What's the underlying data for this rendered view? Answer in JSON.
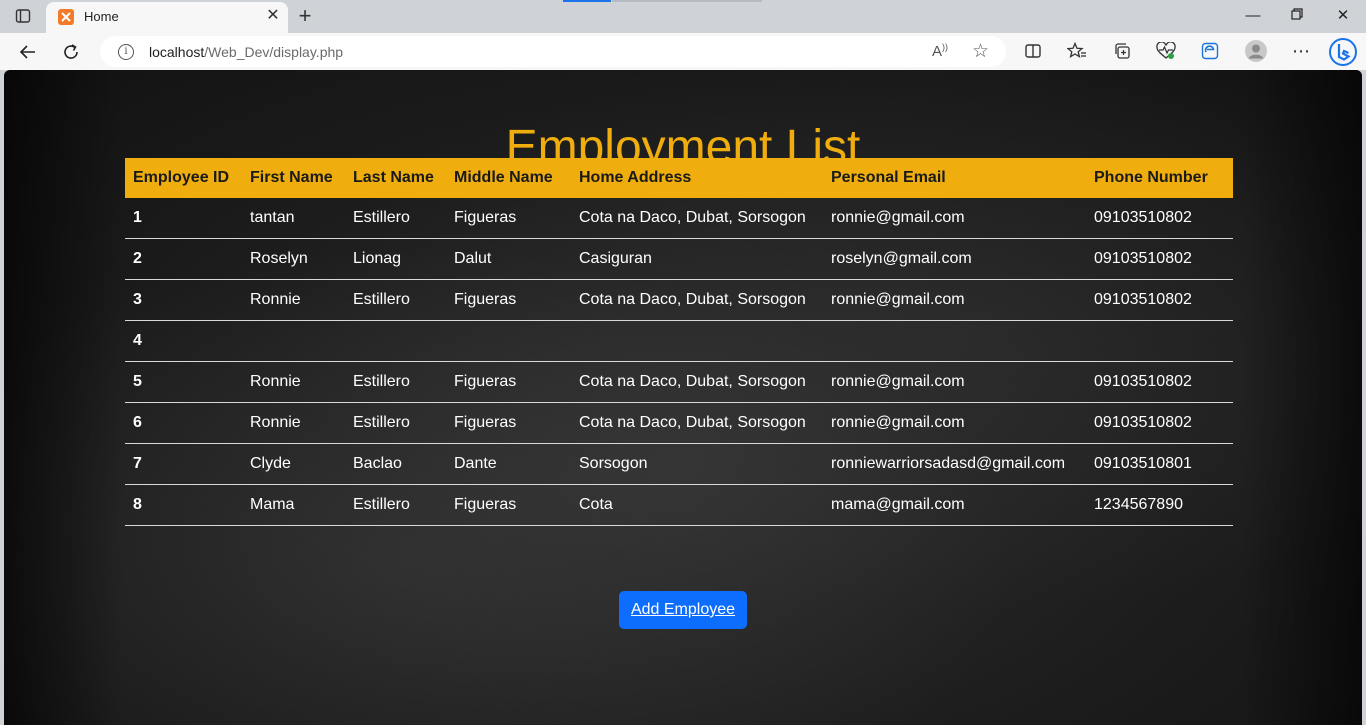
{
  "browser": {
    "tab": {
      "title": "Home"
    },
    "url": {
      "host": "localhost",
      "path": "/Web_Dev/display.php"
    },
    "icons": [
      "sidebar-icon",
      "xampp-favicon",
      "close-icon",
      "plus-icon",
      "minimize-icon",
      "restore-icon",
      "window-close-icon",
      "back-icon",
      "refresh-icon",
      "info-icon",
      "read-aloud-icon",
      "favorite-star-icon",
      "split-screen-icon",
      "favorites-icon",
      "collections-icon",
      "health-icon",
      "edge-icon",
      "profile-avatar",
      "more-icon",
      "bing-icon"
    ]
  },
  "page": {
    "heading": "Employment List",
    "table": {
      "headers": [
        "Employee ID",
        "First Name",
        "Last Name",
        "Middle Name",
        "Home Address",
        "Personal Email",
        "Phone Number"
      ],
      "rows": [
        [
          "1",
          "tantan",
          "Estillero",
          "Figueras",
          "Cota na Daco, Dubat, Sorsogon",
          "ronnie@gmail.com",
          "09103510802"
        ],
        [
          "2",
          "Roselyn",
          "Lionag",
          "Dalut",
          "Casiguran",
          "roselyn@gmail.com",
          "09103510802"
        ],
        [
          "3",
          "Ronnie",
          "Estillero",
          "Figueras",
          "Cota na Daco, Dubat, Sorsogon",
          "ronnie@gmail.com",
          "09103510802"
        ],
        [
          "4",
          "",
          "",
          "",
          "",
          "",
          ""
        ],
        [
          "5",
          "Ronnie",
          "Estillero",
          "Figueras",
          "Cota na Daco, Dubat, Sorsogon",
          "ronnie@gmail.com",
          "09103510802"
        ],
        [
          "6",
          "Ronnie",
          "Estillero",
          "Figueras",
          "Cota na Daco, Dubat, Sorsogon",
          "ronnie@gmail.com",
          "09103510802"
        ],
        [
          "7",
          "Clyde",
          "Baclao",
          "Dante",
          "Sorsogon",
          "ronniewarriorsadasd@gmail.com",
          "09103510801"
        ],
        [
          "8",
          "Mama",
          "Estillero",
          "Figueras",
          "Cota",
          "mama@gmail.com",
          "1234567890"
        ]
      ]
    },
    "add_button": "Add Employee",
    "colors": {
      "accent": "#f0ae0e",
      "button": "#0d6efd"
    }
  }
}
